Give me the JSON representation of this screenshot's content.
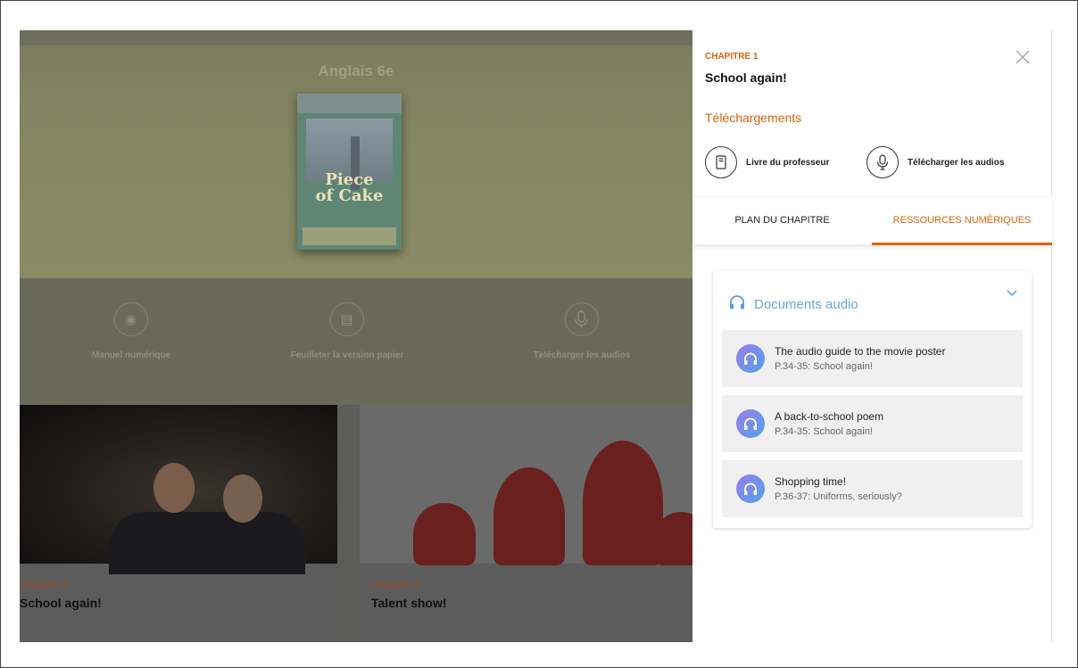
{
  "home": {
    "title": "Anglais 6e",
    "book_cover": {
      "logo_line1": "Piece",
      "logo_line2": "of Cake",
      "grade": "6e"
    },
    "actions": [
      {
        "label": "Manuel numérique",
        "icon": "eye-icon"
      },
      {
        "label": "Feuilleter la version papier",
        "icon": "pdf-icon"
      },
      {
        "label": "Télécharger les audios",
        "icon": "microphone-icon"
      }
    ],
    "chapters": [
      {
        "chapter": "Chapitre 1",
        "name": "School again!"
      },
      {
        "chapter": "Chapitre 2",
        "name": "Talent show!"
      }
    ]
  },
  "drawer": {
    "chapter_label": "CHAPITRE 1",
    "title": "School again!",
    "close_icon": "close-icon",
    "downloads_heading": "Téléchargements",
    "downloads": [
      {
        "label": "Livre du professeur",
        "icon": "book-icon"
      },
      {
        "label": "Télécharger les audios",
        "icon": "microphone-icon"
      }
    ],
    "tabs": [
      {
        "label": "PLAN DU CHAPITRE",
        "active": false
      },
      {
        "label": "RESSOURCES NUMÉRIQUES",
        "active": true
      }
    ],
    "accent_color": "#d9630b",
    "section": {
      "title": "Documents audio",
      "icon": "headphones-icon",
      "items": [
        {
          "title": "The audio guide to the movie poster",
          "subtitle": "P.34-35: School again!"
        },
        {
          "title": "A back-to-school poem",
          "subtitle": "P.34-35: School again!"
        },
        {
          "title": "Shopping time!",
          "subtitle": "P.36-37: Uniforms, seriously?"
        }
      ]
    }
  }
}
